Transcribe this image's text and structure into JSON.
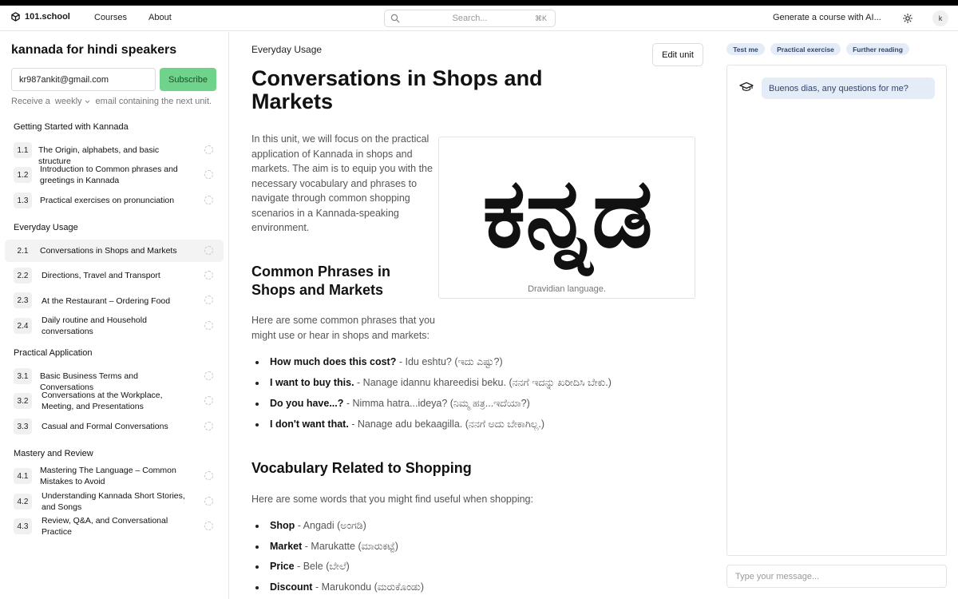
{
  "header": {
    "logo_text": "101.school",
    "nav": [
      "Courses",
      "About"
    ],
    "search_placeholder": "Search...",
    "search_shortcut": "⌘K",
    "generate_label": "Generate a course with AI...",
    "avatar_initial": "k",
    "icons": {
      "logo": "cube-icon",
      "search": "search-icon",
      "theme": "sun-icon"
    }
  },
  "sidebar": {
    "course_title": "kannada for hindi speakers",
    "email_value": "kr987ankit@gmail.com",
    "subscribe_label": "Subscribe",
    "receive_prefix": "Receive a",
    "frequency": "weekly",
    "receive_suffix": "email containing the next unit.",
    "sections": [
      {
        "title": "Getting Started with Kannada",
        "lessons": [
          {
            "num": "1.1",
            "title": "The Origin, alphabets, and basic structure"
          },
          {
            "num": "1.2",
            "title": "Introduction to Common phrases and greetings in Kannada"
          },
          {
            "num": "1.3",
            "title": "Practical exercises on pronunciation"
          }
        ]
      },
      {
        "title": "Everyday Usage",
        "lessons": [
          {
            "num": "2.1",
            "title": "Conversations in Shops and Markets",
            "active": true
          },
          {
            "num": "2.2",
            "title": "Directions, Travel and Transport"
          },
          {
            "num": "2.3",
            "title": "At the Restaurant – Ordering Food"
          },
          {
            "num": "2.4",
            "title": "Daily routine and Household conversations"
          }
        ]
      },
      {
        "title": "Practical Application",
        "lessons": [
          {
            "num": "3.1",
            "title": "Basic Business Terms and Conversations"
          },
          {
            "num": "3.2",
            "title": "Conversations at the Workplace, Meeting, and Presentations"
          },
          {
            "num": "3.3",
            "title": "Casual and Formal Conversations"
          }
        ]
      },
      {
        "title": "Mastery and Review",
        "lessons": [
          {
            "num": "4.1",
            "title": "Mastering The Language – Common Mistakes to Avoid"
          },
          {
            "num": "4.2",
            "title": "Understanding Kannada Short Stories, and Songs"
          },
          {
            "num": "4.3",
            "title": "Review, Q&A, and Conversational Practice"
          }
        ]
      }
    ]
  },
  "main": {
    "breadcrumb": "Everyday Usage",
    "edit_label": "Edit unit",
    "title": "Conversations in Shops and Markets",
    "intro": "In this unit, we will focus on the practical application of Kannada in shops and markets. The aim is to equip you with the necessary vocabulary and phrases to navigate through common shopping scenarios in a Kannada-speaking environment.",
    "figure_text": "ಕನ್ನಡ",
    "figure_caption": "Dravidian language.",
    "phrases_heading": "Common Phrases in Shops and Markets",
    "phrases_intro": "Here are some common phrases that you might use or hear in shops and markets:",
    "phrases": [
      {
        "en": "How much does this cost?",
        "kn": " - Idu eshtu? (ಇದು ಎಷ್ಟು?)"
      },
      {
        "en": "I want to buy this.",
        "kn": " - Nanage idannu khareedisi beku. (ನನಗೆ ಇದನ್ನು ಖರೀದಿಸಿ ಬೇಕು.)"
      },
      {
        "en": "Do you have...?",
        "kn": " - Nimma hatra...ideya? (ನಿಮ್ಮ ಹತ್ರ...ಇದೆಯಾ?)"
      },
      {
        "en": "I don't want that.",
        "kn": " - Nanage adu bekaagilla. (ನನಗೆ ಅದು ಬೇಕಾಗಿಲ್ಲ.)"
      }
    ],
    "vocab_heading": "Vocabulary Related to Shopping",
    "vocab_intro": "Here are some words that you might find useful when shopping:",
    "vocab": [
      {
        "en": "Shop",
        "kn": " - Angadi (ಅಂಗಡಿ)"
      },
      {
        "en": "Market",
        "kn": " - Marukatte (ಮಾರುಕಟ್ಟೆ)"
      },
      {
        "en": "Price",
        "kn": " - Bele (ಬೇಲೆ)"
      },
      {
        "en": "Discount",
        "kn": " - Marukondu (ಮರುಕೊಂಡು)"
      }
    ]
  },
  "assistant": {
    "chips": [
      "Test me",
      "Practical exercise",
      "Further reading"
    ],
    "greeting": "Buenos dias, any questions for me?",
    "input_placeholder": "Type your message...",
    "icon": "graduation-cap-icon"
  }
}
